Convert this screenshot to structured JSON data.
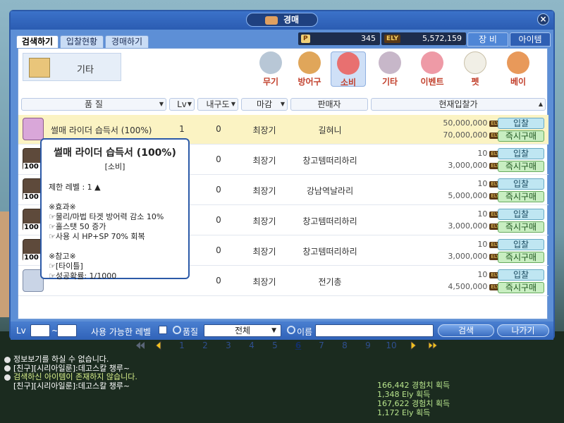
{
  "window": {
    "title": "경매",
    "close": "×"
  },
  "tabs": [
    {
      "label": "검색하기"
    },
    {
      "label": "입찰현황"
    },
    {
      "label": "경매하기"
    }
  ],
  "currency": {
    "p_value": "345",
    "ely_value": "5,572,159",
    "ely_label": "ELY",
    "p_label": "P"
  },
  "right_tabs": [
    {
      "label": "장 비"
    },
    {
      "label": "아이템"
    }
  ],
  "category_box": {
    "label": "기타"
  },
  "categories": [
    {
      "label": "무기"
    },
    {
      "label": "방어구"
    },
    {
      "label": "소비"
    },
    {
      "label": "기타"
    },
    {
      "label": "이벤트"
    },
    {
      "label": "펫"
    },
    {
      "label": "베이"
    }
  ],
  "columns": {
    "quality": "품 질",
    "level": "Lv",
    "durability": "내구도",
    "deadline": "마감",
    "seller": "판매자",
    "bid": "현재입찰가"
  },
  "rows": [
    {
      "name": "썰매 라이더 습득서 (100%)",
      "level": "1",
      "durability": "0",
      "deadline": "최장기",
      "seller": "길혀니",
      "bid": "50,000,000",
      "buyout": "70,000,000",
      "qty": ""
    },
    {
      "name": "",
      "level": "",
      "durability": "0",
      "deadline": "최장기",
      "seller": "창고템떠리하리",
      "bid": "10",
      "buyout": "3,000,000",
      "qty": "100"
    },
    {
      "name": "",
      "level": "",
      "durability": "0",
      "deadline": "최장기",
      "seller": "강남역날라리",
      "bid": "10",
      "buyout": "5,000,000",
      "qty": "100"
    },
    {
      "name": "",
      "level": "",
      "durability": "0",
      "deadline": "최장기",
      "seller": "창고템떠리하리",
      "bid": "10",
      "buyout": "3,000,000",
      "qty": "100"
    },
    {
      "name": "",
      "level": "",
      "durability": "0",
      "deadline": "최장기",
      "seller": "창고템떠리하리",
      "bid": "10",
      "buyout": "3,000,000",
      "qty": "100"
    },
    {
      "name": "",
      "level": "",
      "durability": "0",
      "deadline": "최장기",
      "seller": "전기총",
      "bid": "10",
      "buyout": "4,500,000",
      "qty": ""
    }
  ],
  "buttons": {
    "bid": "입찰",
    "buyout": "즉시구매",
    "search": "검색",
    "exit": "나가기"
  },
  "ely_tag": "ELY",
  "tooltip": {
    "title": "썰매 라이더 습득서 (100%)",
    "subtitle": "[소비]",
    "level": "제한 레벨 : 1 ▲",
    "effect_header": "※효과※",
    "effects": [
      "☞물리/마법 타겟 방어력 감소 10%",
      "☞홀스탯 50 증가",
      "☞사용 시 HP+SP 70% 회복"
    ],
    "note_header": "※참고※",
    "notes": [
      "☞[타이틀]",
      "☞성공확률: 1/1000"
    ]
  },
  "pagination": {
    "pages": [
      "1",
      "2",
      "3",
      "4",
      "5",
      "6",
      "7",
      "8",
      "9",
      "10"
    ],
    "current": "6"
  },
  "bottombar": {
    "lv_label": "Lv",
    "range_sep": "~",
    "usable_label": "사용 가능한 레벨",
    "quality_label": "품질",
    "quality_value": "전체",
    "name_label": "이름"
  },
  "chat": [
    "정보보기를 하실 수 없습니다.",
    "[친구][시리아일룬]:데고스칼 챙루~",
    "검색하신 아이템이 존재하지 않습니다.",
    "[친구][시리아일룬]:데고스칼 챙루~"
  ],
  "exp": [
    "166,442 경험치 획득",
    "1,348 Ely 획득",
    "167,622 경험치 획득",
    "1,172 Ely 획득"
  ],
  "colors": {
    "accent": "#2c5aa8",
    "selected_row": "#fbf3c3",
    "bid_btn": "#bfe6f2",
    "buy_btn": "#c8eec1",
    "category_label": "#c2402c"
  }
}
